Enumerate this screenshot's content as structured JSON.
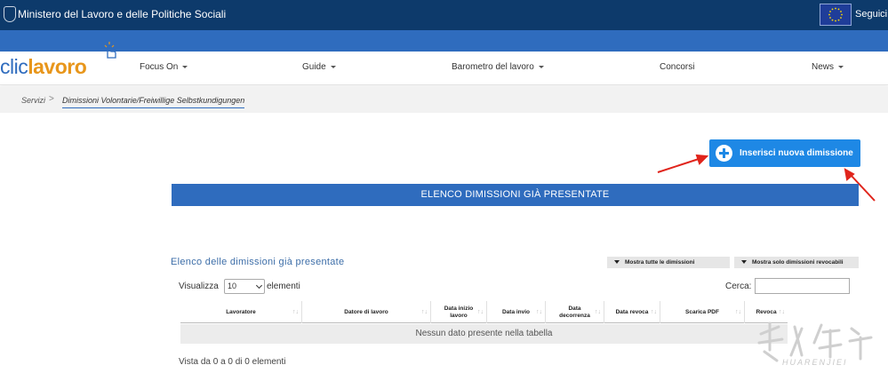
{
  "topbar": {
    "ministry": "Ministero del Lavoro e delle Politiche Sociali",
    "seguici": "Seguici s"
  },
  "logo": {
    "part1": "clic",
    "part2": "lavoro"
  },
  "nav": {
    "items": [
      {
        "label": "Focus On",
        "dropdown": true
      },
      {
        "label": "Guide",
        "dropdown": true
      },
      {
        "label": "Barometro del lavoro",
        "dropdown": true
      },
      {
        "label": "Concorsi",
        "dropdown": false
      },
      {
        "label": "News",
        "dropdown": true
      }
    ]
  },
  "breadcrumb": {
    "root": "Servizi",
    "separator": ">",
    "current": "Dimissioni Volontarie/Freiwillige Selbstkundigungen"
  },
  "actions": {
    "new_resignation": "Inserisci nuova dimissione"
  },
  "banner": {
    "title": "ELENCO DIMISSIONI GIÀ PRESENTATE"
  },
  "list": {
    "title": "Elenco delle dimissioni già presentate",
    "filter_all": "Mostra tutte le dimissioni",
    "filter_revocable": "Mostra solo dimissioni revocabili",
    "length_prefix": "Visualizza",
    "length_value": "10",
    "length_suffix": "elementi",
    "search_label": "Cerca:",
    "search_value": "",
    "columns": [
      "Lavoratore",
      "Datore di lavoro",
      "Data inizio lavoro",
      "Data invio",
      "Data decorrenza",
      "Data revoca",
      "Scarica PDF",
      "Revoca"
    ],
    "empty_message": "Nessun dato presente nella tabella",
    "info": "Vista da 0 a 0 di 0 elementi"
  },
  "colors": {
    "topbar": "#0d3a6b",
    "accent_blue": "#2f6cbe",
    "button_blue": "#1e88e5",
    "logo_orange": "#e8961b",
    "arrow_red": "#e0241b"
  }
}
